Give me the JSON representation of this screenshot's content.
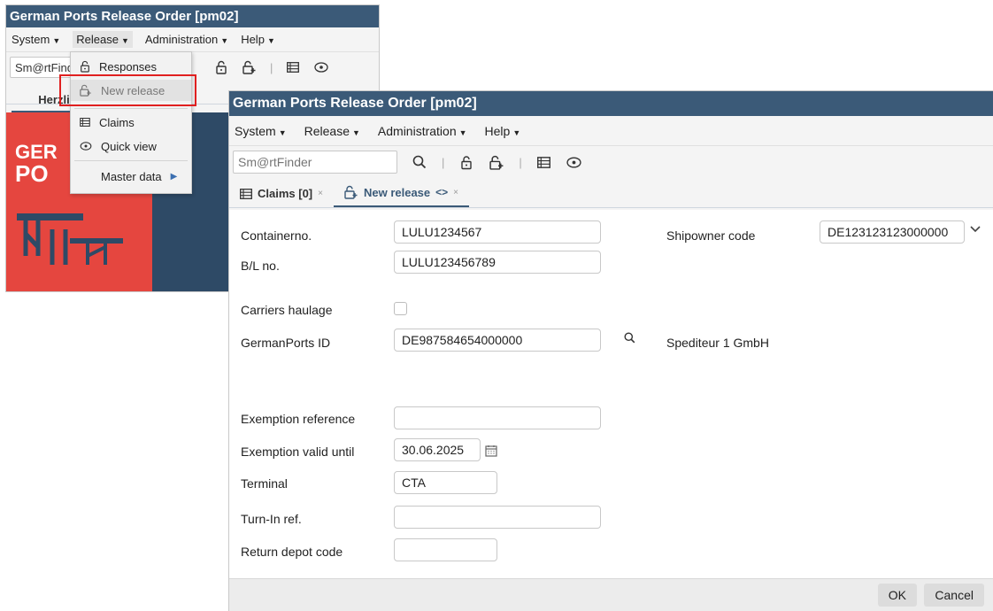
{
  "back_window": {
    "title": "German Ports Release Order [pm02]",
    "menus": [
      {
        "label": "System"
      },
      {
        "label": "Release"
      },
      {
        "label": "Administration"
      },
      {
        "label": "Help"
      }
    ],
    "search_value": "Sm@rtFind",
    "tab_label": "Herzli",
    "logo_line1": "GER",
    "logo_line2": "PO"
  },
  "release_menu": {
    "items": [
      {
        "label": "Responses",
        "icon": "lock-icon"
      },
      {
        "label": "New release",
        "icon": "lock-plus-icon"
      },
      {
        "label": "Claims",
        "icon": "list-icon"
      },
      {
        "label": "Quick view",
        "icon": "eye-icon"
      },
      {
        "label": "Master data",
        "icon": "chevron-right-icon"
      }
    ]
  },
  "front_window": {
    "title": "German Ports Release Order [pm02]",
    "menus": [
      {
        "label": "System"
      },
      {
        "label": "Release"
      },
      {
        "label": "Administration"
      },
      {
        "label": "Help"
      }
    ],
    "search_placeholder": "Sm@rtFinder",
    "tabs": [
      {
        "label": "Claims [0]",
        "close": "×"
      },
      {
        "label": "New release",
        "close": "×"
      }
    ],
    "form": {
      "containerno_label": "Containerno.",
      "containerno_value": "LULU1234567",
      "bl_label": "B/L no.",
      "bl_value": "LULU123456789",
      "shipowner_label": "Shipowner code",
      "shipowner_value": "DE123123123000000",
      "carriers_label": "Carriers haulage",
      "germanports_label": "GermanPorts ID",
      "germanports_value": "DE987584654000000",
      "germanports_name": "Spediteur 1 GmbH",
      "exemption_ref_label": "Exemption reference",
      "exemption_ref_value": "",
      "exemption_valid_label": "Exemption valid until",
      "exemption_valid_value": "30.06.2025",
      "terminal_label": "Terminal",
      "terminal_value": "CTA",
      "turnin_label": "Turn-In ref.",
      "turnin_value": "",
      "return_depot_label": "Return depot code",
      "return_depot_value": ""
    },
    "buttons": {
      "ok": "OK",
      "cancel": "Cancel"
    }
  },
  "colors": {
    "titlebar": "#3b5a78",
    "highlight": "#e02020",
    "logo_red": "#e5463f",
    "logo_navy": "#2e4a66"
  }
}
